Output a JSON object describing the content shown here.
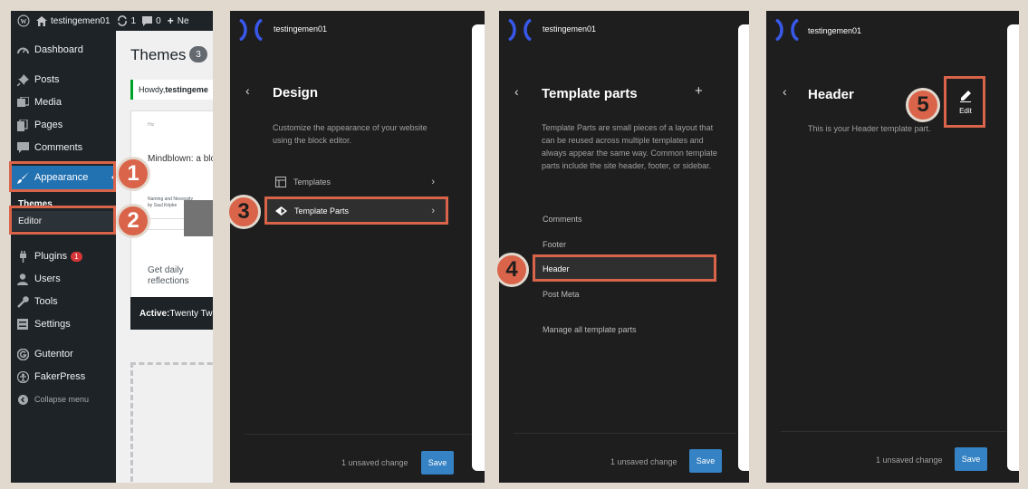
{
  "wp": {
    "adminbar": {
      "site_name": "testingemen01",
      "updates_count": "1",
      "comments_count": "0",
      "new_label": "Ne"
    },
    "menu": {
      "dashboard": "Dashboard",
      "posts": "Posts",
      "media": "Media",
      "pages": "Pages",
      "comments": "Comments",
      "appearance": "Appearance",
      "themes": "Themes",
      "editor": "Editor",
      "plugins": "Plugins",
      "plugins_badge": "1",
      "users": "Users",
      "tools": "Tools",
      "settings": "Settings",
      "gutentor": "Gutentor",
      "fakerpress": "FakerPress",
      "collapse": "Collapse menu"
    },
    "main": {
      "title": "Themes",
      "count": "3",
      "howdy_prefix": "Howdy, ",
      "howdy_name": "testingeme",
      "card_small": "Hiz",
      "card_heading": "Mindblown: a blog",
      "card_line1": "Naming and Necessity",
      "card_line2": "by Saul Kripke",
      "card_daily1": "Get daily",
      "card_daily2": "reflections",
      "active_label": "Active:",
      "active_theme": " Twenty Tw"
    }
  },
  "design": {
    "site_name": "testingemen01",
    "title": "Design",
    "description": "Customize the appearance of your website using the block editor.",
    "nav": {
      "templates": "Templates",
      "template_parts": "Template Parts"
    },
    "unsaved": "1 unsaved change",
    "save": "Save"
  },
  "template_parts": {
    "site_name": "testingemen01",
    "title": "Template parts",
    "description": "Template Parts are small pieces of a layout that can be reused across multiple templates and always appear the same way. Common template parts include the site header, footer, or sidebar.",
    "items": [
      "Comments",
      "Footer",
      "Header",
      "Post Meta"
    ],
    "manage": "Manage all template parts",
    "unsaved": "1 unsaved change",
    "save": "Save"
  },
  "header_panel": {
    "site_name": "testingemen01",
    "title": "Header",
    "description": "This is your Header template part.",
    "edit": "Edit",
    "unsaved": "1 unsaved change",
    "save": "Save"
  },
  "steps": [
    "1",
    "2",
    "3",
    "4",
    "5"
  ],
  "colors": {
    "accent": "#d9644a",
    "wp_blue": "#2271b1",
    "save_blue": "#3582c4",
    "editor_dark": "#1e1e1e",
    "logo": "#3858e9"
  }
}
